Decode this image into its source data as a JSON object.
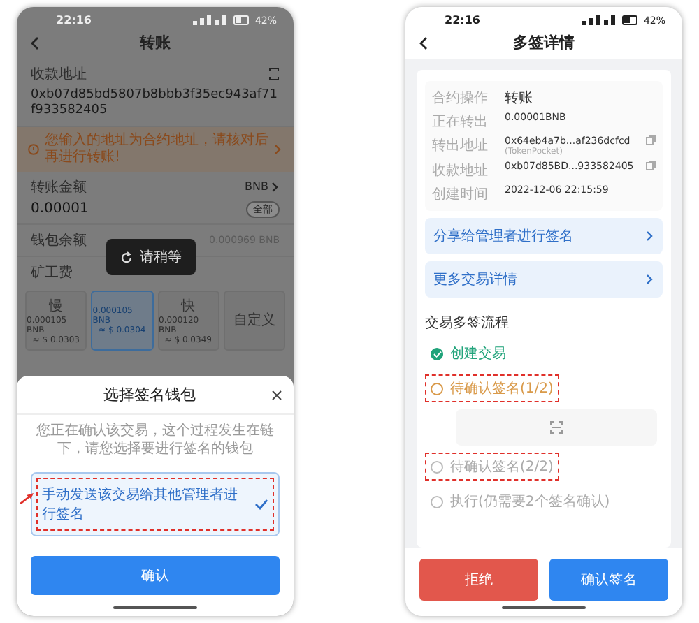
{
  "left_screen": {
    "status_bar": {
      "time": "22:16",
      "battery": "42%"
    },
    "header": {
      "title": "转账"
    },
    "address": {
      "label": "收款地址",
      "value": "0xb07d85bd5807b8bbb3f35ec943af71f933582405"
    },
    "warning": "您输入的地址为合约地址，请核对后再进行转账!",
    "amount": {
      "label": "转账金额",
      "token": "BNB",
      "value": "0.00001",
      "all_button": "全部"
    },
    "balance": {
      "label": "钱包余额",
      "value": "0.000969 BNB"
    },
    "fee": {
      "label": "矿工费",
      "options": [
        {
          "label": "慢",
          "amount": "0.000105 BNB",
          "usd": "≈ $ 0.0303",
          "selected": false
        },
        {
          "amount": "0.000105 BNB",
          "usd": "≈ $ 0.0304",
          "selected": true
        },
        {
          "label": "快",
          "amount": "0.000120 BNB",
          "usd": "≈ $ 0.0349",
          "selected": false
        },
        {
          "label": "自定义",
          "selected": false
        }
      ]
    },
    "toast": "请稍等",
    "dialog": {
      "title": "选择签名钱包",
      "message": "您正在确认该交易，这个过程发生在链下，请您选择要进行签名的钱包",
      "options": [
        {
          "label": "手动发送该交易给其他管理者进行签名",
          "selected": true,
          "highlighted": true
        }
      ],
      "confirm": "确认"
    }
  },
  "right_screen": {
    "status_bar": {
      "time": "22:16",
      "battery": "42%"
    },
    "header": {
      "title": "多签详情"
    },
    "details": [
      {
        "label": "合约操作",
        "value": "转账",
        "copyable": false
      },
      {
        "label": "正在转出",
        "value": "0.00001BNB",
        "copyable": false
      },
      {
        "label": "转出地址",
        "value": "0x64eb4a7b...af236dcfcd",
        "note": "(TokenPocket)",
        "copyable": true
      },
      {
        "label": "收款地址",
        "value": "0xb07d85BD...933582405",
        "copyable": true
      },
      {
        "label": "创建时间",
        "value": "2022-12-06 22:15:59",
        "copyable": false
      }
    ],
    "links": [
      "分享给管理者进行签名",
      "更多交易详情"
    ],
    "flow": {
      "title": "交易多签流程",
      "steps": [
        {
          "label": "创建交易",
          "done": true,
          "current": false,
          "highlighted": false
        },
        {
          "label": "待确认签名(1/2)",
          "done": false,
          "current": true,
          "highlighted": true
        },
        {
          "label": "待确认签名(2/2)",
          "done": false,
          "current": false,
          "highlighted": true
        },
        {
          "label": "执行(仍需要2个签名确认)",
          "done": false,
          "current": false,
          "highlighted": false
        }
      ]
    },
    "buttons": {
      "reject": "拒绝",
      "confirm": "确认签名"
    }
  }
}
